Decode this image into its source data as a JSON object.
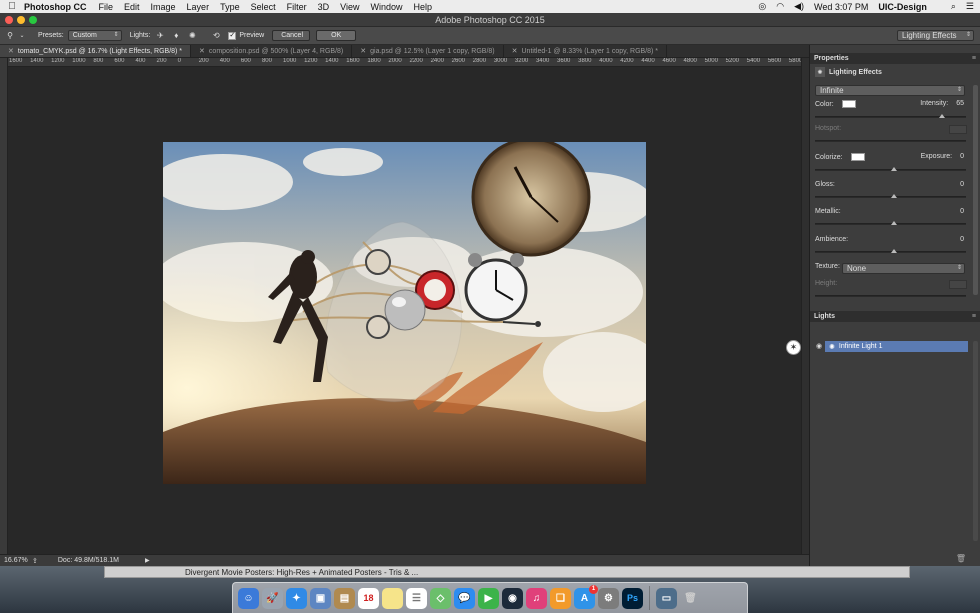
{
  "menubar": {
    "app_name": "Photoshop CC",
    "items": [
      "File",
      "Edit",
      "Image",
      "Layer",
      "Type",
      "Select",
      "Filter",
      "3D",
      "View",
      "Window",
      "Help"
    ],
    "clock": "Wed 3:07 PM",
    "user": "UIC-Design"
  },
  "window": {
    "title": "Adobe Photoshop CC 2015"
  },
  "options": {
    "presets_label": "Presets:",
    "presets_value": "Custom",
    "lights_label": "Lights:",
    "preview_label": "Preview",
    "preview_checked": true,
    "cancel_label": "Cancel",
    "ok_label": "OK",
    "workspace": "Lighting Effects"
  },
  "tabs": [
    {
      "label": "tomato_CMYK.psd @ 16.7% (Light Effects, RGB/8) *",
      "active": true
    },
    {
      "label": "composition.psd @ 500% (Layer 4, RGB/8)",
      "active": false
    },
    {
      "label": "gia.psd @ 12.5% (Layer 1 copy, RGB/8)",
      "active": false
    },
    {
      "label": "Untitled-1 @ 8.33% (Layer 1 copy, RGB/8) *",
      "active": false
    }
  ],
  "ruler": {
    "ticks": [
      "1600",
      "1400",
      "1200",
      "1000",
      "800",
      "600",
      "400",
      "200",
      "0",
      "200",
      "400",
      "600",
      "800",
      "1000",
      "1200",
      "1400",
      "1600",
      "1800",
      "2000",
      "2200",
      "2400",
      "2600",
      "2800",
      "3000",
      "3200",
      "3400",
      "3600",
      "3800",
      "4000",
      "4200",
      "4400",
      "4600",
      "4800",
      "5000",
      "5200",
      "5400",
      "5600",
      "5800"
    ]
  },
  "status": {
    "zoom": "16.67%",
    "doc": "Doc: 49.8M/518.1M"
  },
  "properties": {
    "panel_title": "Properties",
    "section_title": "Lighting Effects",
    "light_type": "Infinite",
    "color_label": "Color:",
    "intensity_label": "Intensity:",
    "intensity_value": "65",
    "intensity_fraction": 0.82,
    "hotspot_label": "Hotspot:",
    "colorize_label": "Colorize:",
    "exposure_label": "Exposure:",
    "exposure_value": "0",
    "gloss_label": "Gloss:",
    "gloss_value": "0",
    "metallic_label": "Metallic:",
    "metallic_value": "0",
    "ambience_label": "Ambience:",
    "ambience_value": "0",
    "texture_label": "Texture:",
    "texture_value": "None",
    "height_label": "Height:"
  },
  "lights_panel": {
    "title": "Lights",
    "items": [
      "Infinite Light 1"
    ]
  },
  "background_window": {
    "title": "Divergent Movie Posters: High-Res + Animated Posters - Tris & ..."
  },
  "dock": {
    "calendar_day": "18",
    "badge": "1",
    "icons": [
      "finder-icon",
      "launchpad-icon",
      "safari-icon",
      "preview-icon",
      "book-icon",
      "calendar-icon",
      "notes-icon",
      "reminders-icon",
      "maps-icon",
      "messages-icon",
      "facetime-icon",
      "music-icon",
      "itunes-icon",
      "ibooks-icon",
      "app-store-icon",
      "system-preferences-icon",
      "photoshop-icon",
      "photos-icon",
      "trash-icon"
    ]
  },
  "colors": {
    "accent_selection": "#5b7bb3",
    "panel_bg": "#3d3d3d",
    "canvas_bg": "#282828"
  }
}
